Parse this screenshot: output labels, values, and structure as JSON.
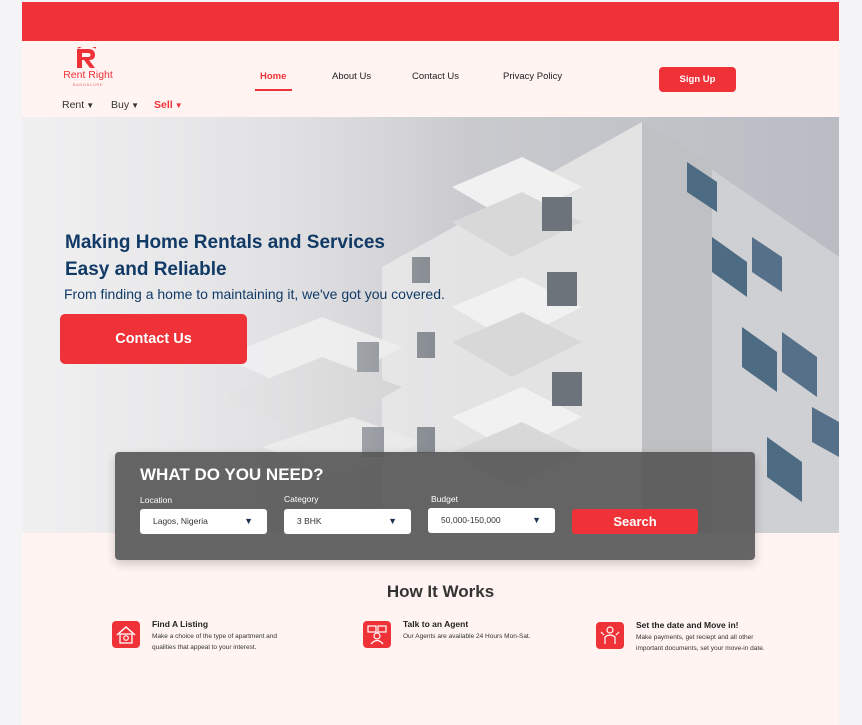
{
  "brand": {
    "name": "Rent Right",
    "city": "BANGALORE",
    "colors": {
      "primary": "#ef3237",
      "navy": "#123a66",
      "background": "#fff4f2"
    }
  },
  "nav": {
    "items": [
      {
        "label": "Home",
        "active": true
      },
      {
        "label": "About Us"
      },
      {
        "label": "Contact Us"
      },
      {
        "label": "Privacy Policy"
      }
    ],
    "signup_label": "Sign Up"
  },
  "subnav": {
    "items": [
      {
        "label": "Rent",
        "icon": "caret-down-icon"
      },
      {
        "label": "Buy",
        "icon": "caret-down-icon"
      },
      {
        "label": "Sell",
        "icon": "caret-down-icon",
        "active": true
      }
    ],
    "caret": "▼"
  },
  "hero": {
    "headline_line1": "Making Home Rentals and Services",
    "headline_line2": "Easy and Reliable",
    "subheadline": "From finding a home to maintaining it, we've got you covered.",
    "cta_label": "Contact Us"
  },
  "search": {
    "title": "WHAT DO YOU NEED?",
    "fields": [
      {
        "label": "Location",
        "value": "Lagos, Nigeria"
      },
      {
        "label": "Category",
        "value": "3 BHK"
      },
      {
        "label": "Budget",
        "value": "50,000-150,000"
      }
    ],
    "button_label": "Search",
    "caret": "▼"
  },
  "how_it_works": {
    "title": "How It Works",
    "steps": [
      {
        "title": "Find A Listing",
        "description": "Make a choice of the type of apartment and qualities that appeal to your interest.",
        "icon": "house-search-icon"
      },
      {
        "title": "Talk to an Agent",
        "description": "Our Agents are available 24 Hours Mon-Sat.",
        "icon": "agent-chat-icon"
      },
      {
        "title": "Set the date and Move in!",
        "description": "Make payments, get reciept and all other important documents, set your move-in date.",
        "icon": "move-in-icon"
      }
    ]
  }
}
